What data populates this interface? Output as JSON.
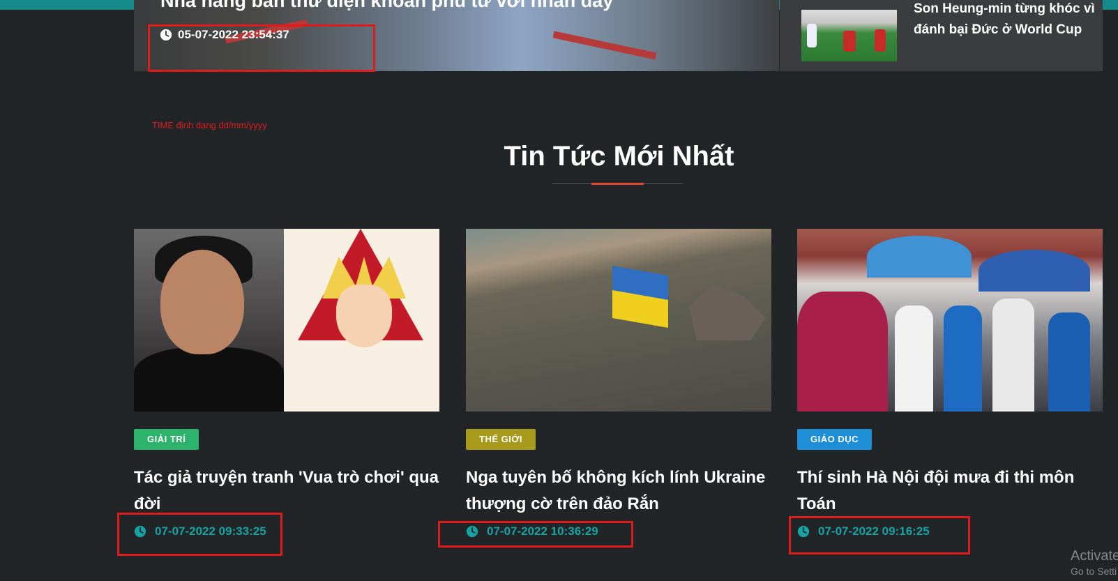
{
  "hero": {
    "title": "Nhà hàng bán thư điện khoản phù từ với nhân dây",
    "time": "05-07-2022 23:54:37"
  },
  "side_article": {
    "title": "Son Heung-min từng khóc vì đánh bại Đức ở World Cup"
  },
  "annotation_note": "TIME định dạng dd/mm/yyyy",
  "section": {
    "title": "Tin Tức Mới Nhất"
  },
  "cards": [
    {
      "category": "GIẢI TRÍ",
      "category_color": "#2db36b",
      "title": "Tác giả truyện tranh 'Vua trò chơi' qua đời",
      "time": "07-07-2022 09:33:25"
    },
    {
      "category": "THẾ GIỚI",
      "category_color": "#a79a1c",
      "title": "Nga tuyên bố không kích lính Ukraine thượng cờ trên đảo Rắn",
      "time": "07-07-2022 10:36:29"
    },
    {
      "category": "GIÁO DỤC",
      "category_color": "#1e8fd6",
      "title": "Thí sinh Hà Nội đội mưa đi thi môn Toán",
      "time": "07-07-2022 09:16:25"
    }
  ],
  "colors": {
    "accent": "#e4452e",
    "time_teal": "#17a3a3",
    "highlight_red": "#e01b1b"
  },
  "watermark": {
    "line1": "Activate",
    "line2": "Go to Setti"
  }
}
